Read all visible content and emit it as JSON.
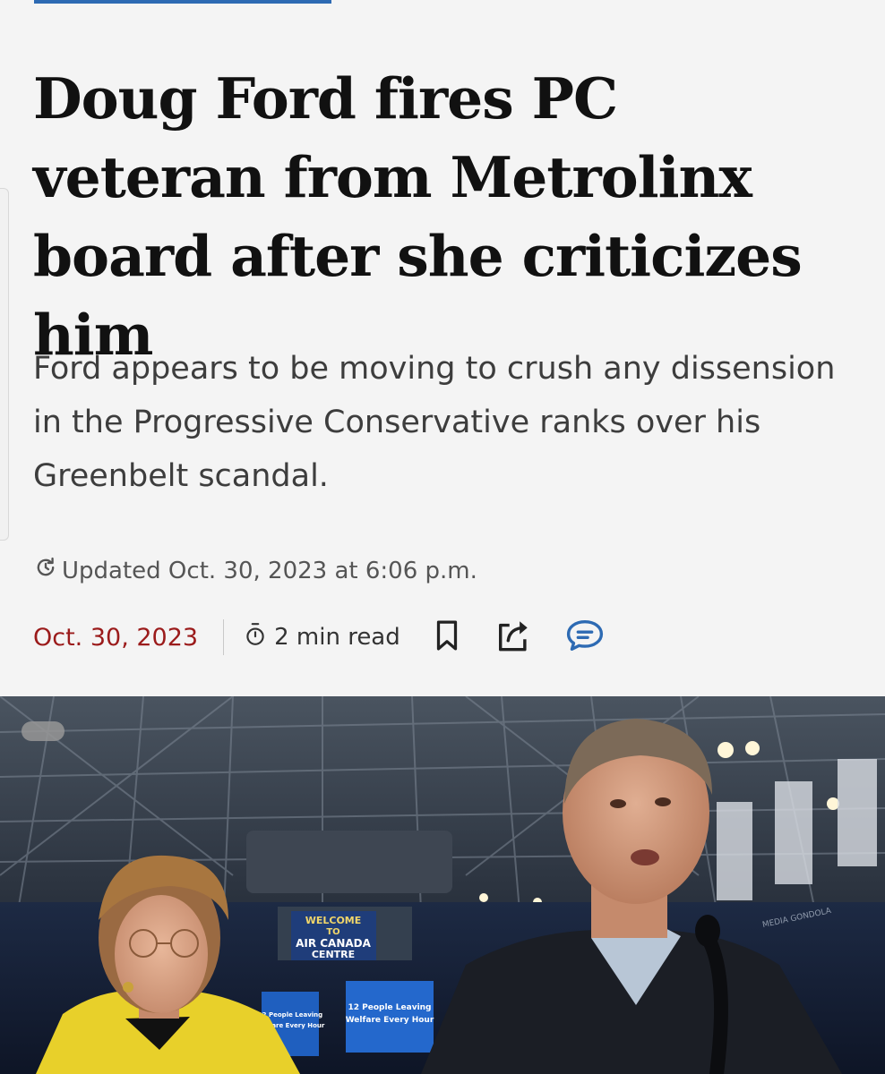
{
  "article": {
    "headline": "Doug Ford fires PC veteran from Metrolinx board after she criticizes him",
    "dek": "Ford appears to be moving to crush any dissension in the Progressive Conservative ranks over his Greenbelt scandal.",
    "updated": "Updated Oct. 30, 2023 at 6:06 p.m.",
    "date": "Oct. 30, 2023",
    "read_time": "2 min read"
  },
  "photo": {
    "sign_line1": "WELCOME",
    "sign_line2": "TO",
    "sign_line3": "AIR CANADA",
    "sign_line4": "CENTRE",
    "screen_left_line1": "12 People Leaving",
    "screen_left_line2": "Welfare Every Hour",
    "screen_right_line1": "12 People Leaving",
    "screen_right_line2": "Welfare Every Hour",
    "gondola_text": "MEDIA GONDOLA"
  },
  "icons": {
    "updated": "refresh-clock-icon",
    "read_time": "stopwatch-icon",
    "bookmark": "bookmark-icon",
    "share": "share-icon",
    "comment": "comment-icon"
  },
  "colors": {
    "accent": "#2d6ab3",
    "date": "#9b1b1b",
    "comment_icon": "#2d6ab3"
  }
}
